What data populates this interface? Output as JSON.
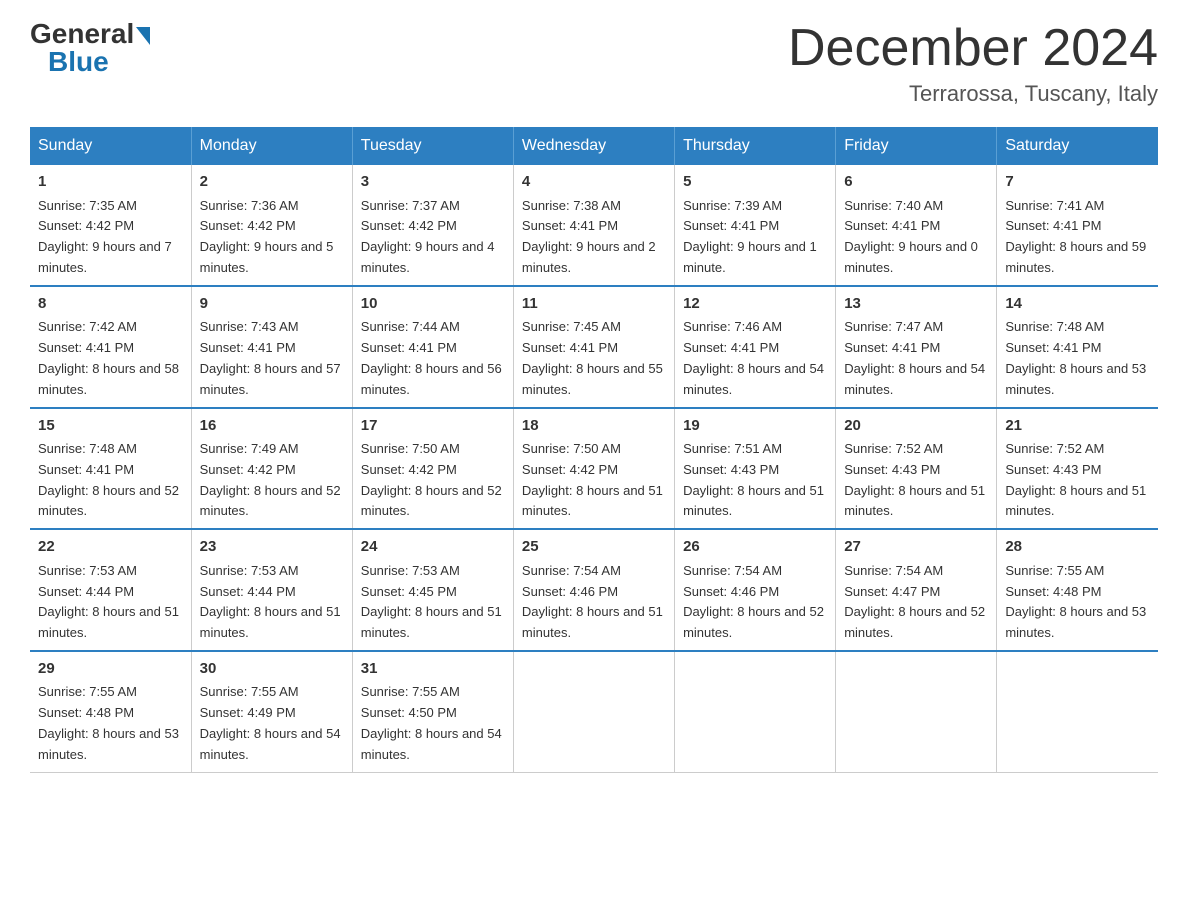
{
  "logo": {
    "general": "General",
    "blue": "Blue"
  },
  "header": {
    "month_year": "December 2024",
    "location": "Terrarossa, Tuscany, Italy"
  },
  "days_of_week": [
    "Sunday",
    "Monday",
    "Tuesday",
    "Wednesday",
    "Thursday",
    "Friday",
    "Saturday"
  ],
  "weeks": [
    [
      {
        "day": "1",
        "sunrise": "7:35 AM",
        "sunset": "4:42 PM",
        "daylight": "9 hours and 7 minutes."
      },
      {
        "day": "2",
        "sunrise": "7:36 AM",
        "sunset": "4:42 PM",
        "daylight": "9 hours and 5 minutes."
      },
      {
        "day": "3",
        "sunrise": "7:37 AM",
        "sunset": "4:42 PM",
        "daylight": "9 hours and 4 minutes."
      },
      {
        "day": "4",
        "sunrise": "7:38 AM",
        "sunset": "4:41 PM",
        "daylight": "9 hours and 2 minutes."
      },
      {
        "day": "5",
        "sunrise": "7:39 AM",
        "sunset": "4:41 PM",
        "daylight": "9 hours and 1 minute."
      },
      {
        "day": "6",
        "sunrise": "7:40 AM",
        "sunset": "4:41 PM",
        "daylight": "9 hours and 0 minutes."
      },
      {
        "day": "7",
        "sunrise": "7:41 AM",
        "sunset": "4:41 PM",
        "daylight": "8 hours and 59 minutes."
      }
    ],
    [
      {
        "day": "8",
        "sunrise": "7:42 AM",
        "sunset": "4:41 PM",
        "daylight": "8 hours and 58 minutes."
      },
      {
        "day": "9",
        "sunrise": "7:43 AM",
        "sunset": "4:41 PM",
        "daylight": "8 hours and 57 minutes."
      },
      {
        "day": "10",
        "sunrise": "7:44 AM",
        "sunset": "4:41 PM",
        "daylight": "8 hours and 56 minutes."
      },
      {
        "day": "11",
        "sunrise": "7:45 AM",
        "sunset": "4:41 PM",
        "daylight": "8 hours and 55 minutes."
      },
      {
        "day": "12",
        "sunrise": "7:46 AM",
        "sunset": "4:41 PM",
        "daylight": "8 hours and 54 minutes."
      },
      {
        "day": "13",
        "sunrise": "7:47 AM",
        "sunset": "4:41 PM",
        "daylight": "8 hours and 54 minutes."
      },
      {
        "day": "14",
        "sunrise": "7:48 AM",
        "sunset": "4:41 PM",
        "daylight": "8 hours and 53 minutes."
      }
    ],
    [
      {
        "day": "15",
        "sunrise": "7:48 AM",
        "sunset": "4:41 PM",
        "daylight": "8 hours and 52 minutes."
      },
      {
        "day": "16",
        "sunrise": "7:49 AM",
        "sunset": "4:42 PM",
        "daylight": "8 hours and 52 minutes."
      },
      {
        "day": "17",
        "sunrise": "7:50 AM",
        "sunset": "4:42 PM",
        "daylight": "8 hours and 52 minutes."
      },
      {
        "day": "18",
        "sunrise": "7:50 AM",
        "sunset": "4:42 PM",
        "daylight": "8 hours and 51 minutes."
      },
      {
        "day": "19",
        "sunrise": "7:51 AM",
        "sunset": "4:43 PM",
        "daylight": "8 hours and 51 minutes."
      },
      {
        "day": "20",
        "sunrise": "7:52 AM",
        "sunset": "4:43 PM",
        "daylight": "8 hours and 51 minutes."
      },
      {
        "day": "21",
        "sunrise": "7:52 AM",
        "sunset": "4:43 PM",
        "daylight": "8 hours and 51 minutes."
      }
    ],
    [
      {
        "day": "22",
        "sunrise": "7:53 AM",
        "sunset": "4:44 PM",
        "daylight": "8 hours and 51 minutes."
      },
      {
        "day": "23",
        "sunrise": "7:53 AM",
        "sunset": "4:44 PM",
        "daylight": "8 hours and 51 minutes."
      },
      {
        "day": "24",
        "sunrise": "7:53 AM",
        "sunset": "4:45 PM",
        "daylight": "8 hours and 51 minutes."
      },
      {
        "day": "25",
        "sunrise": "7:54 AM",
        "sunset": "4:46 PM",
        "daylight": "8 hours and 51 minutes."
      },
      {
        "day": "26",
        "sunrise": "7:54 AM",
        "sunset": "4:46 PM",
        "daylight": "8 hours and 52 minutes."
      },
      {
        "day": "27",
        "sunrise": "7:54 AM",
        "sunset": "4:47 PM",
        "daylight": "8 hours and 52 minutes."
      },
      {
        "day": "28",
        "sunrise": "7:55 AM",
        "sunset": "4:48 PM",
        "daylight": "8 hours and 53 minutes."
      }
    ],
    [
      {
        "day": "29",
        "sunrise": "7:55 AM",
        "sunset": "4:48 PM",
        "daylight": "8 hours and 53 minutes."
      },
      {
        "day": "30",
        "sunrise": "7:55 AM",
        "sunset": "4:49 PM",
        "daylight": "8 hours and 54 minutes."
      },
      {
        "day": "31",
        "sunrise": "7:55 AM",
        "sunset": "4:50 PM",
        "daylight": "8 hours and 54 minutes."
      },
      {
        "day": "",
        "sunrise": "",
        "sunset": "",
        "daylight": ""
      },
      {
        "day": "",
        "sunrise": "",
        "sunset": "",
        "daylight": ""
      },
      {
        "day": "",
        "sunrise": "",
        "sunset": "",
        "daylight": ""
      },
      {
        "day": "",
        "sunrise": "",
        "sunset": "",
        "daylight": ""
      }
    ]
  ],
  "labels": {
    "sunrise": "Sunrise:",
    "sunset": "Sunset:",
    "daylight": "Daylight:"
  }
}
